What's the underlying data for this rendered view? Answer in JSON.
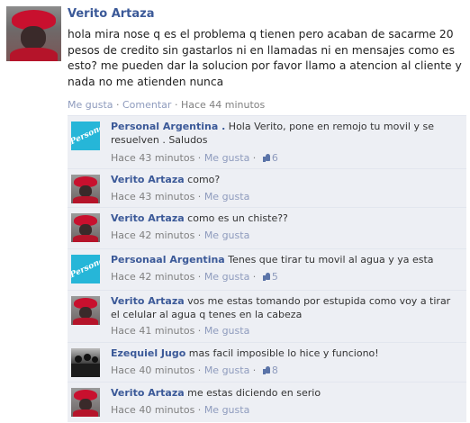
{
  "post": {
    "author": "Verito Artaza",
    "text": "hola mira nose q es el problema q tienen pero acaban de sacarme 20 pesos de credito sin gastarlos ni en llamadas ni en mensajes como es esto? me pueden dar la solucion por favor llamo a atencion al cliente y nada no me atienden nunca",
    "like": "Me gusta",
    "comment": "Comentar",
    "time": "Hace 44 minutos"
  },
  "comments": [
    {
      "author": "Personal Argentina .",
      "text": " Hola Verito, pone en remojo tu movil y se resuelven . Saludos",
      "time": "Hace 43 minutos",
      "like": "Me gusta",
      "likes": "6"
    },
    {
      "author": "Verito Artaza",
      "text": " como?",
      "time": "Hace 43 minutos",
      "like": "Me gusta"
    },
    {
      "author": "Verito Artaza",
      "text": " como es un chiste??",
      "time": "Hace 42 minutos",
      "like": "Me gusta"
    },
    {
      "author": "Personaal Argentina",
      "text": " Tenes que tirar tu movil al agua y ya esta",
      "time": "Hace 42 minutos",
      "like": "Me gusta",
      "likes": "5"
    },
    {
      "author": "Verito Artaza",
      "text": " vos me estas tomando por estupida como voy a tirar el celular al agua q tenes en la cabeza",
      "time": "Hace 41 minutos",
      "like": "Me gusta"
    },
    {
      "author": "Ezequiel Jugo",
      "text": " mas facil imposible lo hice y funciono!",
      "time": "Hace 40 minutos",
      "like": "Me gusta",
      "likes": "8"
    },
    {
      "author": "Verito Artaza",
      "text": " me estas diciendo en serio",
      "time": "Hace 40 minutos",
      "like": "Me gusta"
    }
  ],
  "avatar_logo_text": "Personal",
  "colors": {
    "author_link": "#3b5998",
    "comment_bg": "#edeff4",
    "brand_cyan": "#26b6d8"
  }
}
